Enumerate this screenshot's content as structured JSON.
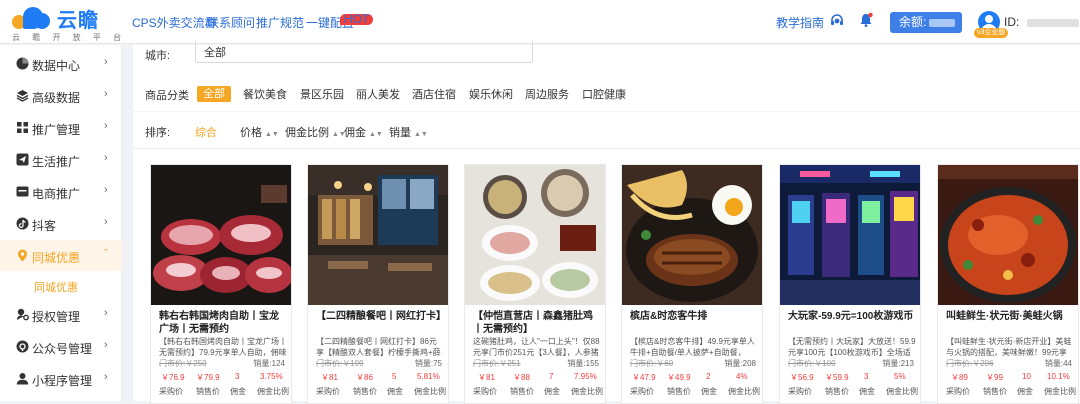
{
  "brand": {
    "name": "云瞻",
    "tagline": "云 瞻 开 放 平 台"
  },
  "topnav": [
    "CPS外卖交流群",
    "联系顾问",
    "推广规范",
    "一键配置"
  ],
  "topnav_badge": "HOT",
  "guide": "教学指南",
  "balance_label": "余额:",
  "user": {
    "id_label": "ID:",
    "vip": "v3企业版"
  },
  "sidebar": [
    {
      "label": "数据中心",
      "icon": "chart-icon"
    },
    {
      "label": "高级数据",
      "icon": "database-icon"
    },
    {
      "label": "推广管理",
      "icon": "grid-icon"
    },
    {
      "label": "生活推广",
      "icon": "send-icon"
    },
    {
      "label": "电商推广",
      "icon": "shop-icon"
    },
    {
      "label": "抖客",
      "icon": "tiktok-icon"
    },
    {
      "label": "同城优惠",
      "icon": "location-icon"
    },
    {
      "label": "授权管理",
      "icon": "key-icon"
    },
    {
      "label": "公众号管理",
      "icon": "wechat-icon"
    },
    {
      "label": "小程序管理",
      "icon": "miniprogram-icon"
    }
  ],
  "sidebar_sub": "同城优惠",
  "filters": {
    "city_label": "城市:",
    "city_value": "全部",
    "category_label": "商品分类",
    "categories": [
      "全部",
      "餐饮美食",
      "景区乐园",
      "丽人美发",
      "酒店住宿",
      "娱乐休闲",
      "周边服务",
      "口腔健康"
    ],
    "sort_label": "排序:",
    "sorts": [
      "综合",
      "价格",
      "佣金比例",
      "佣金",
      "销量"
    ]
  },
  "labels": {
    "buy": "采购价",
    "sell": "销售价",
    "comm": "佣金",
    "rate": "佣金比例",
    "orig_prefix": "门市价:",
    "sold_prefix": "销量:"
  },
  "products": [
    {
      "title": "韩右右韩国烤肉自助丨宝龙广场丨无需预约",
      "desc": "【韩右右韩国烤肉自助丨宝龙广场丨无需预约】79.9元享单人自助，佣味牛…",
      "orig": "￥250",
      "sold": "124",
      "buy": "￥76.9",
      "sell": "￥79.9",
      "comm": "3",
      "rate": "3.75%"
    },
    {
      "title": "【二四精酿餐吧丨网红打卡】",
      "desc": "【二四精酿餐吧丨网红打卡】86元享【精酿双人套餐】柠檬手撕鸡+薛香无…",
      "orig": "￥199",
      "sold": "75",
      "buy": "￥81",
      "sell": "￥86",
      "comm": "5",
      "rate": "5.81%"
    },
    {
      "title": "【仲恺直营店丨森鑫猪肚鸡丨无需预约】",
      "desc": "这碗猪肚鸡，让人\"一口上头\"！仅88元享门市价251元【3人餐】，人参猪肚…",
      "orig": "￥251",
      "sold": "155",
      "buy": "￥81",
      "sell": "￥88",
      "comm": "7",
      "rate": "7.95%"
    },
    {
      "title": "槟店&时恋客牛排",
      "desc": "【槟店&时恋客牛排】49.9元享单人牛排+自助餐/单人披萨+自助餐，128元享…",
      "orig": "￥60",
      "sold": "208",
      "buy": "￥47.9",
      "sell": "￥49.9",
      "comm": "2",
      "rate": "4%"
    },
    {
      "title": "大玩家-59.9元=100枚游戏币",
      "desc": "【无需预约丨大玩家】大放送！59.9元享100元【100枚游戏币】全场适用！",
      "orig": "￥100",
      "sold": "213",
      "buy": "￥56.9",
      "sell": "￥59.9",
      "comm": "3",
      "rate": "5%"
    },
    {
      "title": "叫蛙鲜生·状元街·美蛙火锅",
      "desc": "【叫蛙鲜生·状元街·新店开业】美蛙与火锅的搭配，美味鲜嫩！99元享门市价…",
      "orig": "￥206",
      "sold": "44",
      "buy": "￥89",
      "sell": "￥99",
      "comm": "10",
      "rate": "10.1%"
    }
  ],
  "colors": {
    "accent": "#f5a623",
    "brand": "#1f7cf5",
    "price": "#f23d3d",
    "link": "#2a6dd8"
  }
}
